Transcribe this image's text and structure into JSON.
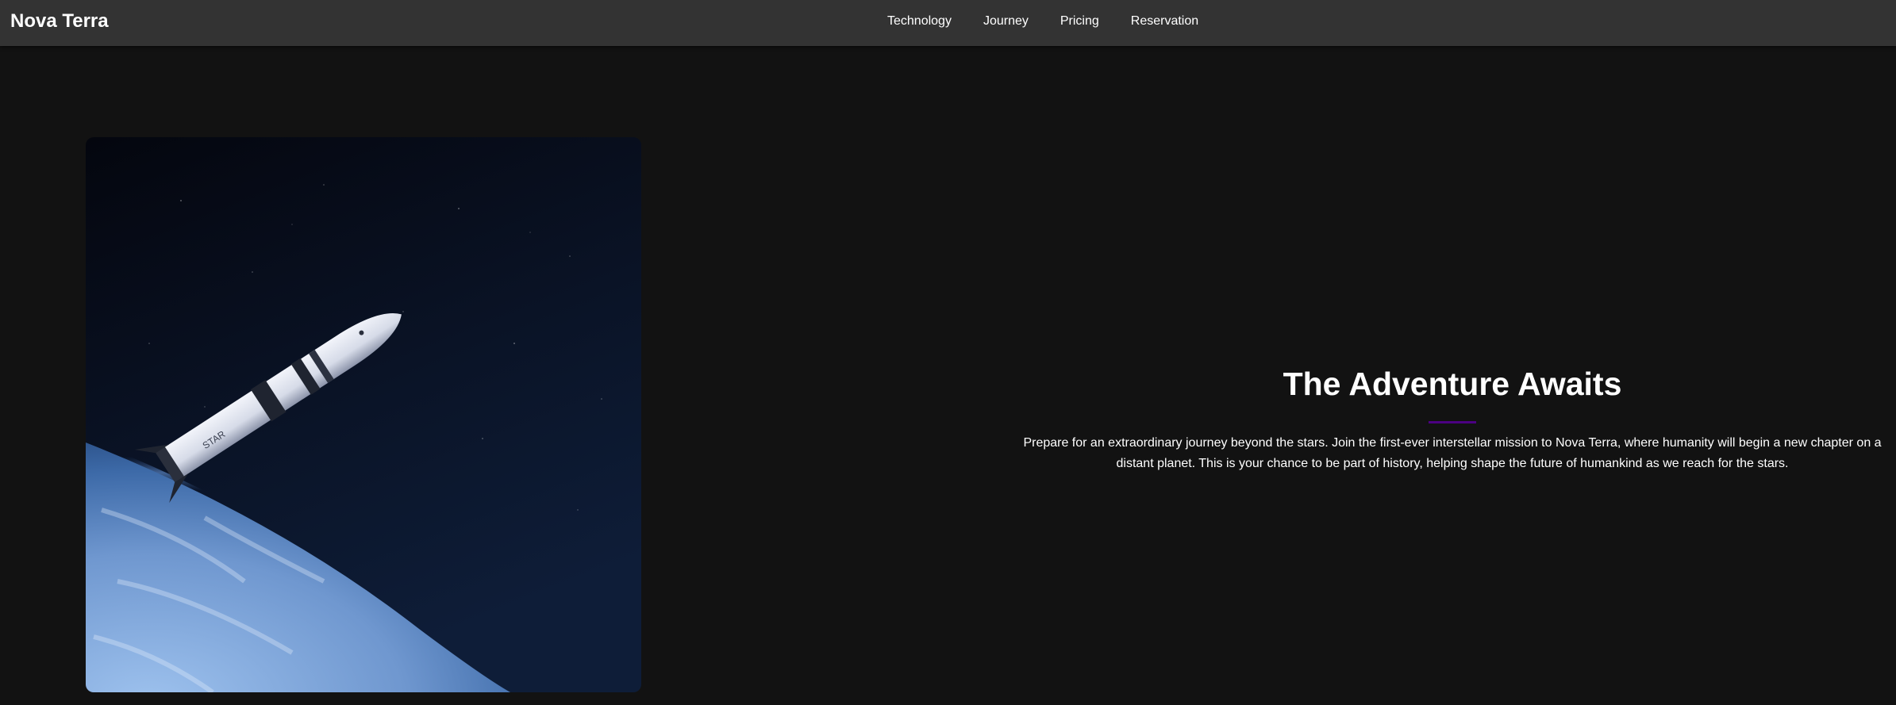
{
  "nav": {
    "brand": "Nova Terra",
    "links": [
      "Technology",
      "Journey",
      "Pricing",
      "Reservation"
    ]
  },
  "hero": {
    "image_alt": "rocket-in-orbit-over-planet",
    "title": "The Adventure Awaits",
    "description": "Prepare for an extraordinary journey beyond the stars. Join the first-ever interstellar mission to Nova Terra, where humanity will begin a new chapter on a distant planet. This is your chance to be part of history, helping shape the future of humankind as we reach for the stars."
  },
  "colors": {
    "background": "#121212",
    "navbar": "#333333",
    "accent": "#4b0082",
    "text": "#ffffff"
  }
}
